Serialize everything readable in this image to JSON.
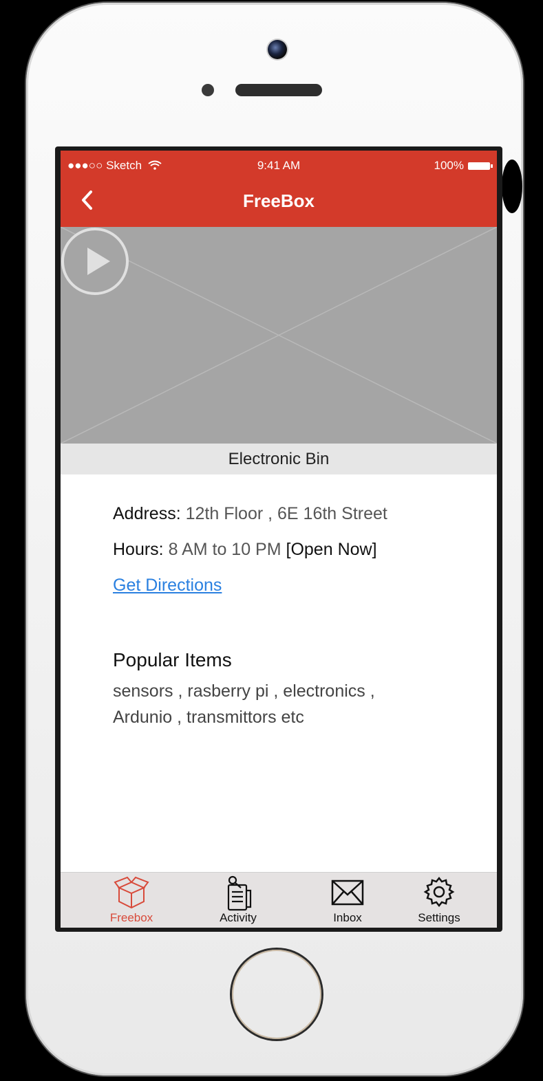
{
  "status_bar": {
    "carrier": "●●●○○ Sketch",
    "time": "9:41 AM",
    "battery": "100%"
  },
  "nav": {
    "title": "FreeBox"
  },
  "bin": {
    "name": "Electronic Bin"
  },
  "details": {
    "address_label": "Address:",
    "address_value": "12th Floor , 6E 16th Street",
    "hours_label": "Hours:",
    "hours_value": "8 AM to 10 PM",
    "hours_status": "[Open Now]",
    "directions_link": "Get Directions"
  },
  "popular": {
    "title": "Popular Items",
    "text_line1": "sensors , rasberry pi , electronics ,",
    "text_line2": "Ardunio , transmittors etc"
  },
  "tabs": [
    {
      "label": "Freebox",
      "icon": "box-icon",
      "active": true
    },
    {
      "label": "Activity",
      "icon": "clipboard-icon",
      "active": false
    },
    {
      "label": "Inbox",
      "icon": "envelope-icon",
      "active": false
    },
    {
      "label": "Settings",
      "icon": "gear-icon",
      "active": false
    }
  ],
  "colors": {
    "accent": "#d33a2a",
    "link": "#2a80e0",
    "active_tab": "#d84a3a"
  }
}
